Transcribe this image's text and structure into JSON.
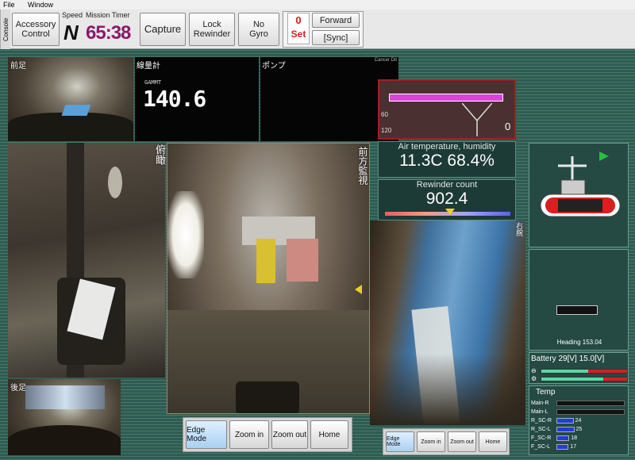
{
  "menu": {
    "items": [
      "File",
      "Window"
    ]
  },
  "toolbar": {
    "console_tab": "Console",
    "accessory_control": "Accessory\nControl",
    "speed_label": "Speed",
    "speed_value": "N",
    "mission_timer_label": "Mission Timer",
    "mission_timer_value": "65:38",
    "capture": "Capture",
    "lock_rewinder": "Lock\nRewinder",
    "no_gyro": "No\nGyro",
    "counter_value": "0",
    "set_label": "Set",
    "forward": "Forward",
    "sync": "[Sync]"
  },
  "cameras": {
    "front_left_label": "前足",
    "meter_label": "線量計",
    "meter_value_small": "GAMMT",
    "meter_value": "140.6",
    "pump_label": "ポンプ",
    "pump_note": "Cancer Dit",
    "overhead_label": "俯瞰",
    "front_direction_label": "前方監視",
    "rear_label": "後足",
    "right_label": "右腕"
  },
  "main_view_controls": [
    "Edge Mode",
    "Zoom in",
    "Zoom out",
    "Home"
  ],
  "right_view_controls": [
    "Edge Mode",
    "Zoom in",
    "Zoom out",
    "Home"
  ],
  "gauge": {
    "tick_top": "60",
    "tick_bottom": "120",
    "value": "0"
  },
  "environment": {
    "label": "Air temperature, humidity",
    "temperature": "11.3C",
    "humidity": "68.4%"
  },
  "rewinder": {
    "label": "Rewinder count",
    "value": "902.4"
  },
  "heading": {
    "label": "Heading",
    "value": "153.04",
    "text": "Heading 153.04"
  },
  "battery": {
    "label": "Battery",
    "voltage_1": "29[V]",
    "voltage_2": "15.0[V]",
    "level_1": 0.55,
    "level_2": 0.72
  },
  "temperature": {
    "title": "Temp",
    "rows": [
      {
        "name": "Main-R",
        "value": ""
      },
      {
        "name": "Main-L",
        "value": ""
      },
      {
        "name": "R_SC-R",
        "value": "24"
      },
      {
        "name": "R_SC-L",
        "value": "25"
      },
      {
        "name": "F_SC-R",
        "value": "18"
      },
      {
        "name": "F_SC-L",
        "value": "17"
      }
    ]
  },
  "colors": {
    "accent_red": "#e0202a",
    "accent_magenta": "#e040e0",
    "bar_blue": "#1f3fd0",
    "battery_green": "#5fd4a8",
    "flag_green": "#28c040"
  }
}
